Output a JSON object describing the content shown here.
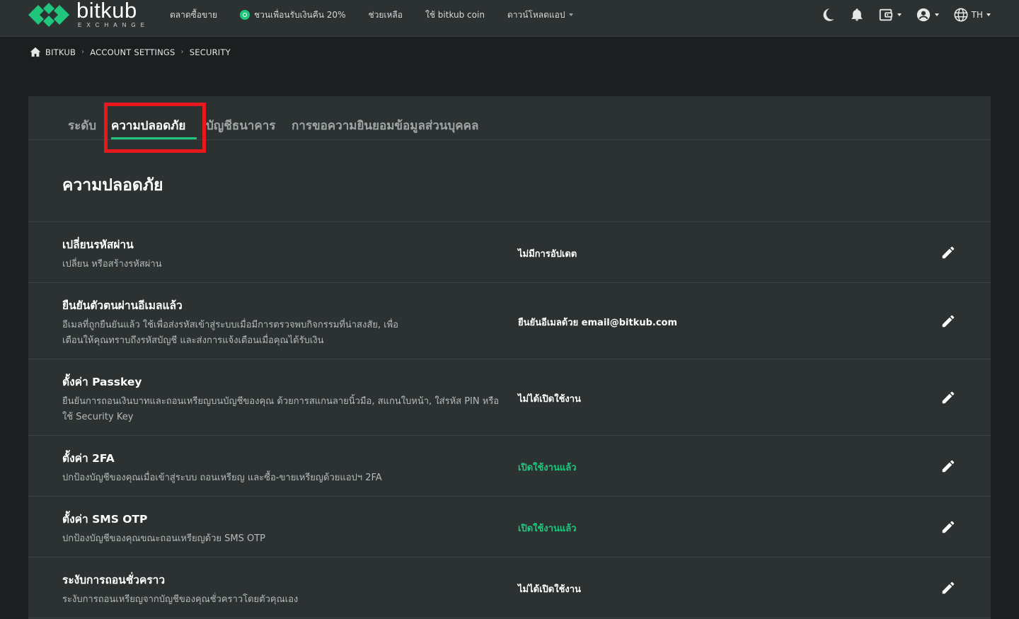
{
  "colors": {
    "accent": "#1fc77c",
    "nav_bg": "#2c3132",
    "page_bg": "#1b1f20",
    "highlight": "#e8181f"
  },
  "brand": {
    "name": "bitkub",
    "tagline": "EXCHANGE"
  },
  "nav": {
    "market": "ตลาดซื้อขาย",
    "invite": "ชวนเพื่อนรับเงินคืน 20%",
    "help": "ช่วยเหลือ",
    "coin": "ใช้ bitkub coin",
    "download": "ดาวน์โหลดแอป",
    "lang": "TH",
    "icons": [
      "moon-icon",
      "bell-icon",
      "wallet-icon",
      "user-icon",
      "globe-icon"
    ]
  },
  "breadcrumb": {
    "home": "BITKUB",
    "settings": "ACCOUNT SETTINGS",
    "current": "SECURITY"
  },
  "tabs": [
    {
      "label": "ระดับ"
    },
    {
      "label": "ความปลอดภัย",
      "active": true
    },
    {
      "label": "บัญชีธนาคาร"
    },
    {
      "label": "การขอความยินยอมข้อมูลส่วนบุคคล"
    }
  ],
  "section": {
    "title": "ความปลอดภัย"
  },
  "rows": [
    {
      "title": "เปลี่ยนรหัสผ่าน",
      "desc": "เปลี่ยน หรือสร้างรหัสผ่าน",
      "status": "ไม่มีการอัปเดต",
      "status_ok": false
    },
    {
      "title": "ยืนยันตัวตนผ่านอีเมลแล้ว",
      "desc": "อีเมลที่ถูกยืนยันแล้ว ใช้เพื่อส่งรหัสเข้าสู่ระบบเมื่อมีการตรวจพบกิจกรรมที่น่าสงสัย, เพื่อเตือนให้คุณทราบถึงรหัสบัญชี และส่งการแจ้งเตือนเมื่อคุณได้รับเงิน",
      "status": "ยืนยันอีเมลด้วย email@bitkub.com",
      "status_ok": false
    },
    {
      "title": "ตั้งค่า Passkey",
      "desc": "ยืนยันการถอนเงินบาทและถอนเหรียญบนบัญชีของคุณ ด้วยการสแกนลายนิ้วมือ, สแกนใบหน้า, ใส่รหัส PIN หรือใช้ Security Key",
      "status": "ไม่ได้เปิดใช้งาน",
      "status_ok": false
    },
    {
      "title": "ตั้งค่า 2FA",
      "desc": "ปกป้องบัญชีของคุณเมื่อเข้าสู่ระบบ ถอนเหรียญ และซื้อ-ขายเหรียญด้วยแอปฯ 2FA",
      "status": "เปิดใช้งานแล้ว",
      "status_ok": true
    },
    {
      "title": "ตั้งค่า SMS OTP",
      "desc": "ปกป้องบัญชีของคุณขณะถอนเหรียญด้วย SMS OTP",
      "status": "เปิดใช้งานแล้ว",
      "status_ok": true
    },
    {
      "title": "ระงับการถอนชั่วคราว",
      "desc": "ระงับการถอนเหรียญจากบัญชีของคุณชั่วคราวโดยตัวคุณเอง",
      "status": "ไม่ได้เปิดใช้งาน",
      "status_ok": false
    }
  ]
}
